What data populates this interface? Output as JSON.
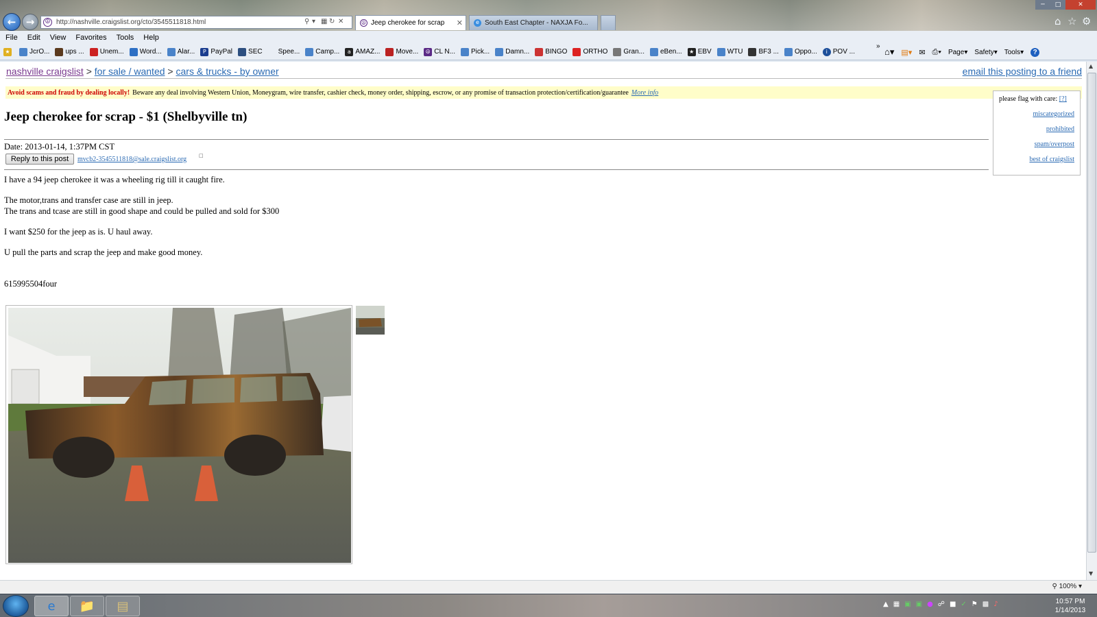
{
  "browser": {
    "url": "http://nashville.craigslist.org/cto/3545511818.html",
    "tabs": [
      {
        "label": "Jeep cherokee for scrap",
        "active": true
      },
      {
        "label": "South East Chapter - NAXJA Fo...",
        "active": false
      }
    ],
    "menu": [
      "File",
      "Edit",
      "View",
      "Favorites",
      "Tools",
      "Help"
    ],
    "favorites": [
      "JcrO...",
      "ups ...",
      "Unem...",
      "Word...",
      "Alar...",
      "PayPal",
      "SEC",
      "Spee...",
      "Camp...",
      "AMAZ...",
      "Move...",
      "CL N...",
      "Pick...",
      "Damn...",
      "BINGO",
      "ORTHO",
      "Gran...",
      "eBen...",
      "EBV",
      "WTU",
      "BF3 ...",
      "Oppo...",
      "POV ..."
    ],
    "command_bar": [
      "Page",
      "Safety",
      "Tools"
    ],
    "zoom": "100%"
  },
  "page": {
    "breadcrumb": [
      "nashville craigslist",
      "for sale / wanted",
      "cars & trucks - by owner"
    ],
    "breadcrumb_separator": ">",
    "email_friend": "email this posting to a friend",
    "scam_warning": {
      "bold": "Avoid scams and fraud by dealing locally!",
      "text": "Beware any deal involving Western Union, Moneygram, wire transfer, cashier check, money order, shipping, escrow, or any promise of transaction protection/certification/guarantee",
      "link": "More info"
    },
    "flag_box": {
      "title": "please flag with care:",
      "help": "[?]",
      "links": [
        "miscategorized",
        "prohibited",
        "spam/overpost",
        "best of craigslist"
      ]
    },
    "title": "Jeep cherokee for scrap - $1 (Shelbyville tn)",
    "date": "Date: 2013-01-14, 1:37PM CST",
    "reply_button": "Reply to this post",
    "reply_email": "mvcb2-3545511818@sale.craigslist.org",
    "body": {
      "p1": "I have a 94 jeep cherokee it was a wheeling rig till it caught fire.",
      "p2a": "The motor,trans and transfer case are still in jeep.",
      "p2b": "The trans and tcase are still in good shape and could be pulled and sold for $300",
      "p3": "I want $250 for the jeep as is. U haul away.",
      "p4": "U pull the parts and scrap the jeep and make good money."
    },
    "phone": "615995504four"
  },
  "taskbar": {
    "time": "10:57 PM",
    "date": "1/14/2013"
  },
  "colors": {
    "link": "#2a6ab3",
    "visited": "#7a3a8f",
    "warning_red": "#cc0000",
    "warning_bg": "#fffdc9"
  }
}
